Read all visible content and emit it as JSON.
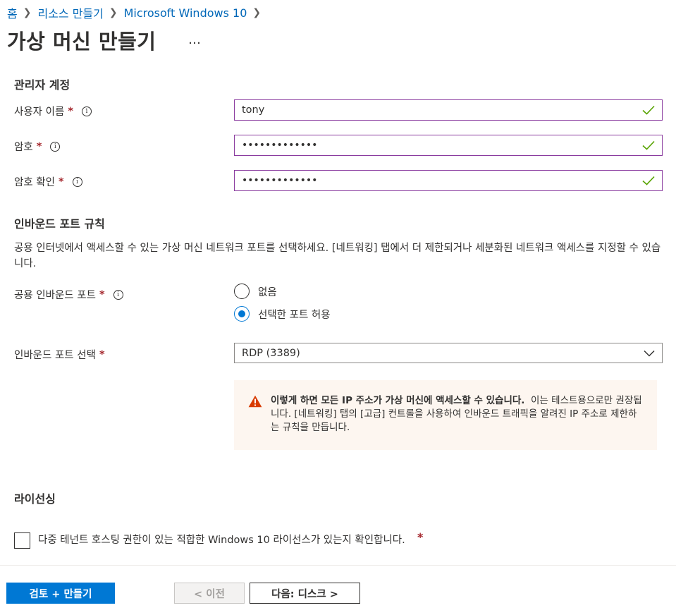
{
  "breadcrumb": [
    {
      "label": "홈"
    },
    {
      "label": "리소스 만들기"
    },
    {
      "label": "Microsoft Windows 10"
    }
  ],
  "page_title": "가상 머신 만들기",
  "more_label": "…",
  "admin": {
    "section_title": "관리자 계정",
    "username_label": "사용자 이름",
    "username_value": "tony",
    "password_label": "암호",
    "password_value": "•••••••••••••",
    "confirm_label": "암호 확인",
    "confirm_value": "•••••••••••••",
    "required_mark": "*"
  },
  "inbound": {
    "section_title": "인바운드 포트 규칙",
    "description": "공용 인터넷에서 액세스할 수 있는 가상 머신 네트워크 포트를 선택하세요. [네트워킹] 탭에서 더 제한되거나 세분화된 네트워크 액세스를 지정할 수 있습니다.",
    "public_ports_label": "공용 인바운드 포트",
    "options": [
      "없음",
      "선택한 포트 허용"
    ],
    "selected_option": "선택한 포트 허용",
    "select_ports_label": "인바운드 포트 선택",
    "select_ports_value": "RDP (3389)",
    "warning_bold": "이렇게 하면 모든 IP 주소가 가상 머신에 액세스할 수 있습니다.",
    "warning_rest": "이는 테스트용으로만 권장됩니다. [네트워킹] 탭의 [고급] 컨트롤을 사용하여 인바운드 트래픽을 알려진 IP 주소로 제한하는 규칙을 만듭니다."
  },
  "licensing": {
    "section_title": "라이선싱",
    "checkbox_label": "다중 테넌트 호스팅 권한이 있는 적합한 Windows 10 라이선스가 있는지 확인합니다.",
    "checked": false
  },
  "footer": {
    "review_create": "검토 + 만들기",
    "previous": "< 이전",
    "next": "다음: 디스크 >"
  },
  "colors": {
    "primary": "#0078d4",
    "link": "#0067b8",
    "input_focus_border": "#8a3b9f",
    "valid_check": "#57a300",
    "required": "#a4262c",
    "warning_bg": "#fdf6f0",
    "warning_icon": "#d83b01"
  }
}
